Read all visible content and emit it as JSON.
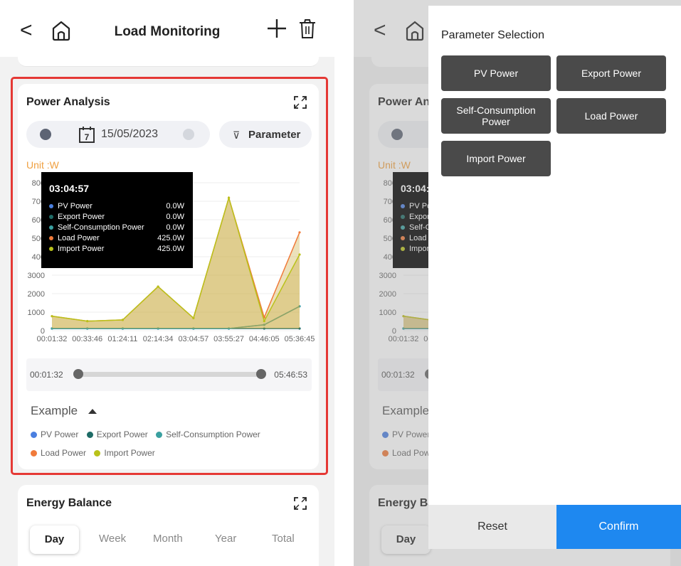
{
  "header": {
    "title": "Load Monitoring",
    "back_icon": "chevron-left-icon",
    "home_icon": "home-icon",
    "add_icon": "plus-icon",
    "delete_icon": "trash-icon"
  },
  "power_analysis": {
    "title": "Power Analysis",
    "date": "15/05/2023",
    "parameter_label": "Parameter",
    "unit": "Unit :W",
    "y_ticks": [
      "800",
      "700",
      "600",
      "500",
      "400",
      "3000",
      "2000",
      "1000",
      "0"
    ],
    "x_ticks": [
      "00:01:32",
      "00:33:46",
      "01:24:11",
      "02:14:34",
      "03:04:57",
      "03:55:27",
      "04:46:05",
      "05:36:45"
    ],
    "tooltip": {
      "time": "03:04:57",
      "rows": [
        {
          "name": "PV Power",
          "value": "0.0W",
          "color": "#4a7fe0"
        },
        {
          "name": "Export Power",
          "value": "0.0W",
          "color": "#1e6b66"
        },
        {
          "name": "Self-Consumption Power",
          "value": "0.0W",
          "color": "#3aa0a0"
        },
        {
          "name": "Load Power",
          "value": "425.0W",
          "color": "#f07a3a"
        },
        {
          "name": "Import Power",
          "value": "425.0W",
          "color": "#b9c21a"
        }
      ]
    },
    "range_start": "00:01:32",
    "range_end": "05:46:53",
    "example_label": "Example",
    "legend": [
      {
        "name": "PV Power",
        "color": "#4a7fe0"
      },
      {
        "name": "Export Power",
        "color": "#1e6b66"
      },
      {
        "name": "Self-Consumption Power",
        "color": "#3aa0a0"
      },
      {
        "name": "Load Power",
        "color": "#f07a3a"
      },
      {
        "name": "Import Power",
        "color": "#b9c21a"
      }
    ]
  },
  "energy_balance": {
    "title": "Energy Balance",
    "tabs": [
      "Day",
      "Week",
      "Month",
      "Year",
      "Total"
    ]
  },
  "parameter_panel": {
    "title": "Parameter Selection",
    "options": [
      "PV Power",
      "Export Power",
      "Self-Consumption Power",
      "Load Power",
      "Import Power"
    ],
    "reset": "Reset",
    "confirm": "Confirm"
  },
  "colors": {
    "highlight": "#e53935",
    "confirm": "#1e88f0",
    "chip": "#4a4a4a",
    "unit": "#f0a040"
  },
  "chart_data": {
    "type": "area",
    "title": "Power Analysis",
    "ylabel": "Unit :W",
    "x": [
      "00:01:32",
      "00:33:46",
      "01:24:11",
      "02:14:34",
      "03:04:57",
      "03:55:27",
      "04:46:05",
      "05:36:45"
    ],
    "series": [
      {
        "name": "PV Power",
        "values": [
          0,
          0,
          0,
          0,
          0,
          0,
          150,
          900
        ]
      },
      {
        "name": "Export Power",
        "values": [
          0,
          0,
          0,
          0,
          0,
          0,
          0,
          0
        ]
      },
      {
        "name": "Self-Consumption Power",
        "values": [
          0,
          0,
          0,
          0,
          0,
          0,
          150,
          900
        ]
      },
      {
        "name": "Load Power",
        "values": [
          500,
          300,
          350,
          1700,
          425,
          5300,
          450,
          3900
        ]
      },
      {
        "name": "Import Power",
        "values": [
          500,
          300,
          350,
          1700,
          425,
          5300,
          300,
          3000
        ]
      }
    ]
  }
}
